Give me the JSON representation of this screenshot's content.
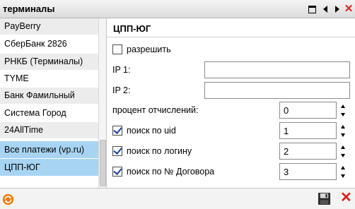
{
  "window": {
    "title": "терминалы"
  },
  "list": {
    "items": [
      {
        "label": "PayBerry"
      },
      {
        "label": "СберБанк 2826"
      },
      {
        "label": "РНКБ (Терминалы)"
      },
      {
        "label": "TYME"
      },
      {
        "label": "Банк Фамильный"
      },
      {
        "label": "Система Город"
      },
      {
        "label": "24AllTime"
      },
      {
        "label": "Все платежи (vp.ru)"
      },
      {
        "label": "ЦПП-ЮГ"
      }
    ],
    "selected": "ЦПП-ЮГ"
  },
  "panel": {
    "title": "ЦПП-ЮГ",
    "allow": {
      "label": "разрешить",
      "checked": false
    },
    "ip1": {
      "label": "IP 1:",
      "value": ""
    },
    "ip2": {
      "label": "IP 2:",
      "value": ""
    },
    "percent": {
      "label": "процент отчислений:",
      "value": "0"
    },
    "search_uid": {
      "label": "поиск по uid",
      "checked": true,
      "value": "1"
    },
    "search_login": {
      "label": "поиск по логину",
      "checked": true,
      "value": "2"
    },
    "search_contract": {
      "label": "поиск по № Договора",
      "checked": true,
      "value": "3"
    }
  },
  "colors": {
    "selected_row": "#a8d4f4",
    "close": "#e02020",
    "refresh": "#f07800",
    "check": "#1a3f9e"
  }
}
